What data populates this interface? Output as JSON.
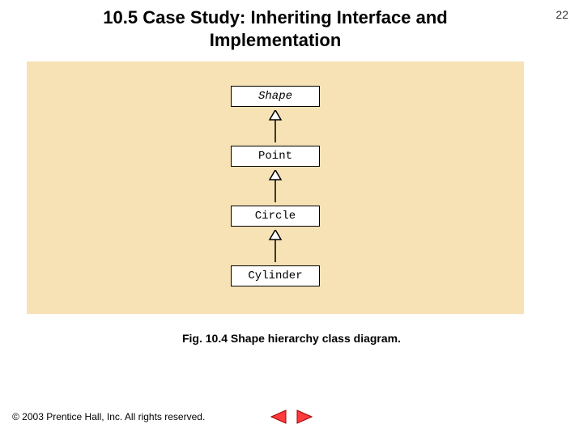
{
  "header": {
    "title": "10.5   Case Study: Inheriting Interface and Implementation",
    "page_number": "22"
  },
  "diagram": {
    "boxes": [
      {
        "label": "Shape",
        "italic": true
      },
      {
        "label": "Point",
        "italic": false
      },
      {
        "label": "Circle",
        "italic": false
      },
      {
        "label": "Cylinder",
        "italic": false
      }
    ]
  },
  "caption": "Fig. 10.4 Shape hierarchy class diagram.",
  "footer": {
    "copyright": "© 2003 Prentice Hall, Inc.  All rights reserved."
  },
  "nav": {
    "prev": "previous-slide",
    "next": "next-slide"
  },
  "colors": {
    "diagram_bg": "#f7e2b6",
    "nav_fill": "#ff3b3b",
    "nav_stroke": "#a00000"
  }
}
